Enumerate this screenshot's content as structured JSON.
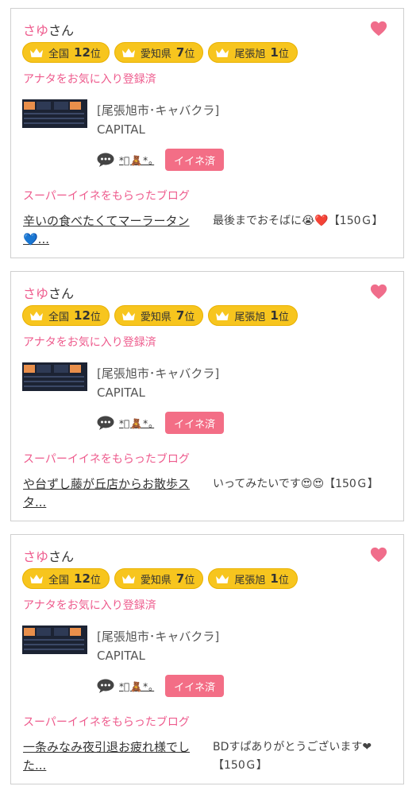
{
  "cards": [
    {
      "user": "さゆ",
      "suffix": "さん",
      "badges": [
        {
          "label": "全国",
          "rank": "12",
          "unit": "位"
        },
        {
          "label": "愛知県",
          "rank": "7",
          "unit": "位"
        },
        {
          "label": "尾張旭",
          "rank": "1",
          "unit": "位"
        }
      ],
      "fav_status": "アナタをお気に入り登録済",
      "shop_area": "[尾張旭市･キャバクラ]",
      "shop_name": "CAPITAL",
      "kaomoji": "*ﾟ🧸*｡",
      "iine_label": "イイネ済",
      "super_label": "スーパーイイネをもらったブログ",
      "blog_title": "辛いの食べたくてマーラータン💙...",
      "comment": "最後までおそばに😭❤️【150Ｇ】"
    },
    {
      "user": "さゆ",
      "suffix": "さん",
      "badges": [
        {
          "label": "全国",
          "rank": "12",
          "unit": "位"
        },
        {
          "label": "愛知県",
          "rank": "7",
          "unit": "位"
        },
        {
          "label": "尾張旭",
          "rank": "1",
          "unit": "位"
        }
      ],
      "fav_status": "アナタをお気に入り登録済",
      "shop_area": "[尾張旭市･キャバクラ]",
      "shop_name": "CAPITAL",
      "kaomoji": "*ﾟ🧸*｡",
      "iine_label": "イイネ済",
      "super_label": "スーパーイイネをもらったブログ",
      "blog_title": "や台ずし藤が丘店からお散歩スタ...",
      "comment": "いってみたいです😍😍【150Ｇ】"
    },
    {
      "user": "さゆ",
      "suffix": "さん",
      "badges": [
        {
          "label": "全国",
          "rank": "12",
          "unit": "位"
        },
        {
          "label": "愛知県",
          "rank": "7",
          "unit": "位"
        },
        {
          "label": "尾張旭",
          "rank": "1",
          "unit": "位"
        }
      ],
      "fav_status": "アナタをお気に入り登録済",
      "shop_area": "[尾張旭市･キャバクラ]",
      "shop_name": "CAPITAL",
      "kaomoji": "*ﾟ🧸*｡",
      "iine_label": "イイネ済",
      "super_label": "スーパーイイネをもらったブログ",
      "blog_title": "一条みなみ夜引退お疲れ様でした...",
      "comment": "BDすぱありがとうございます❤【150Ｇ】"
    }
  ],
  "colors": {
    "accent_pink": "#ee5b8d",
    "heart": "#f06d8b",
    "badge_gold": "#f7c51e",
    "button_pink": "#f36e86"
  },
  "icons": {
    "favorite": "heart-icon",
    "rank": "crown-icon",
    "message": "speech-bubble-icon"
  }
}
